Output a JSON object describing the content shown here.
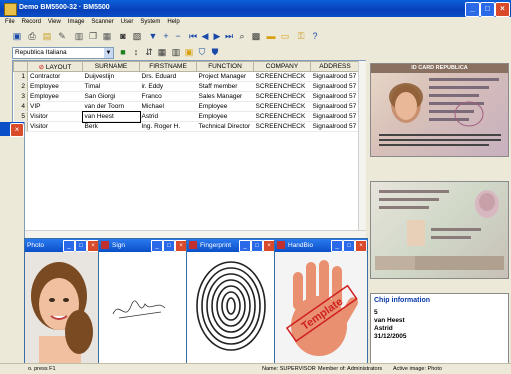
{
  "window": {
    "title": "Demo BM5500-32 · BM5500"
  },
  "menu": [
    "File",
    "Record",
    "View",
    "Image",
    "Scanner",
    "User",
    "System",
    "Help"
  ],
  "toolbar": {
    "icons": [
      "save-icon",
      "print-icon",
      "open-icon",
      "edit-icon",
      "delete-icon",
      "copy-icon",
      "paste-icon",
      "camera-icon",
      "scan-icon",
      "filter-icon",
      "add-icon",
      "remove-icon",
      "first-icon",
      "prev-icon",
      "next-icon",
      "last-icon",
      "search-icon",
      "report-icon",
      "card-icon",
      "chip-icon",
      "key-icon",
      "help-icon"
    ]
  },
  "toolbar2": {
    "database": "Republica Italiana"
  },
  "grid": {
    "columns": [
      "LAYOUT",
      "SURNAME",
      "FIRSTNAME",
      "FUNCTION",
      "COMPANY",
      "ADDRESS"
    ],
    "rows": [
      [
        "1",
        "Contractor",
        "Duijvestijn",
        "Drs. Eduard",
        "Project Manager",
        "SCREENCHECK",
        "Signaalrood 57"
      ],
      [
        "2",
        "Employee",
        "Timal",
        "ir. Eddy",
        "Staff member",
        "SCREENCHECK",
        "Signaalrood 57"
      ],
      [
        "3",
        "Employee",
        "San Giorgi",
        "Franco",
        "Sales Manager",
        "SCREENCHECK",
        "Signaalrood 57"
      ],
      [
        "4",
        "VIP",
        "van der Toorn",
        "Michael",
        "Employee",
        "SCREENCHECK",
        "Signaalrood 57"
      ],
      [
        "5",
        "Visitor",
        "van Heest",
        "Astrid",
        "Employee",
        "SCREENCHECK",
        "Signaalrood 57"
      ],
      [
        "",
        "Visitor",
        "Berk",
        "Ing. Roger H.",
        "Technical Director",
        "SCREENCHECK",
        "Signaalrood 57"
      ]
    ]
  },
  "panels": {
    "photo": "Photo",
    "sign": "Sign",
    "fingerprint": "Fingerprint",
    "handbio": "HandBio",
    "template_stamp": "Template"
  },
  "card": {
    "title": "ID CARD REPUBLICA"
  },
  "chip": {
    "title": "Chip information",
    "number": "5",
    "surname": "van Heest",
    "firstname": "Astrid",
    "date": "31/12/2005"
  },
  "status": {
    "left": "o. press F1",
    "name": "Name: SUPERVISOR",
    "member": "Member of: Administrators",
    "mode": "Active image: Photo"
  },
  "colors": {
    "title_blue": "#0a4fc8",
    "chip_title": "#0a3aa8",
    "close_red": "#d84a2a"
  }
}
